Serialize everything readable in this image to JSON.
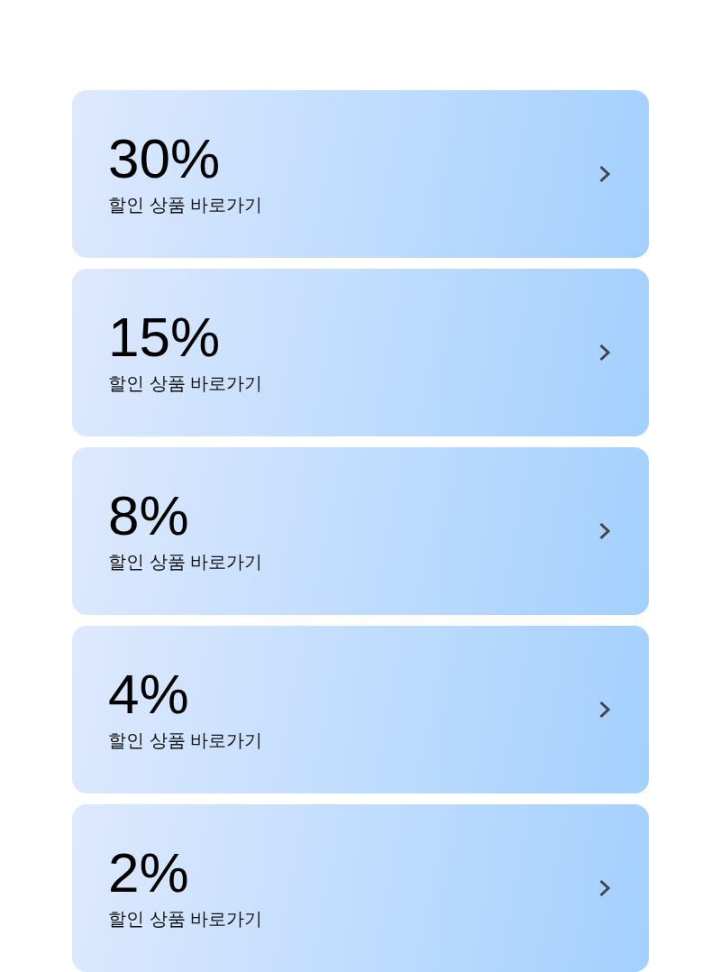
{
  "cards": [
    {
      "discount": "30%",
      "label": "할인 상품 바로가기"
    },
    {
      "discount": "15%",
      "label": "할인 상품 바로가기"
    },
    {
      "discount": "8%",
      "label": "할인 상품 바로가기"
    },
    {
      "discount": "4%",
      "label": "할인 상품 바로가기"
    },
    {
      "discount": "2%",
      "label": "할인 상품 바로가기"
    }
  ]
}
